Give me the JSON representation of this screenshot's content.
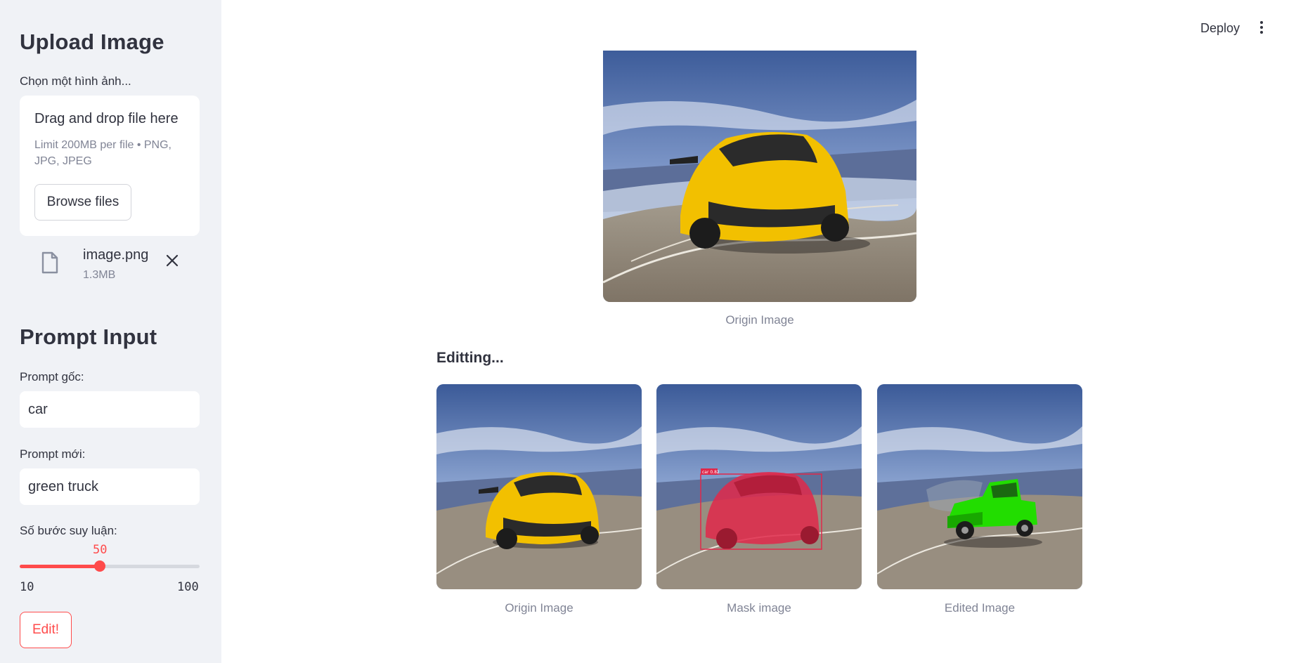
{
  "sidebar": {
    "upload_heading": "Upload Image",
    "upload_label": "Chọn một hình ảnh...",
    "dropzone": {
      "title": "Drag and drop file here",
      "limit": "Limit 200MB per file • PNG, JPG, JPEG",
      "browse_label": "Browse files"
    },
    "file": {
      "name": "image.png",
      "size": "1.3MB"
    },
    "prompt_heading": "Prompt Input",
    "prompt_orig_label": "Prompt gốc:",
    "prompt_orig_value": "car",
    "prompt_new_label": "Prompt mới:",
    "prompt_new_value": "green truck",
    "steps_label": "Số bước suy luận:",
    "steps": {
      "value": "50",
      "min": "10",
      "max": "100",
      "fraction": 0.444
    },
    "edit_label": "Edit!"
  },
  "header": {
    "deploy_label": "Deploy"
  },
  "main": {
    "top_caption": "Origin Image",
    "section_title": "Editting...",
    "gallery": [
      {
        "caption": "Origin Image",
        "variant": "yellow-car"
      },
      {
        "caption": "Mask image",
        "variant": "mask"
      },
      {
        "caption": "Edited Image",
        "variant": "green-truck"
      }
    ],
    "mask_box_label": "car 0.82"
  },
  "colors": {
    "accent": "#ff4b4b",
    "sidebar_bg": "#f0f2f6",
    "car_yellow": "#f2c000",
    "truck_green": "#22dd00",
    "mask_red": "#e0284a"
  }
}
